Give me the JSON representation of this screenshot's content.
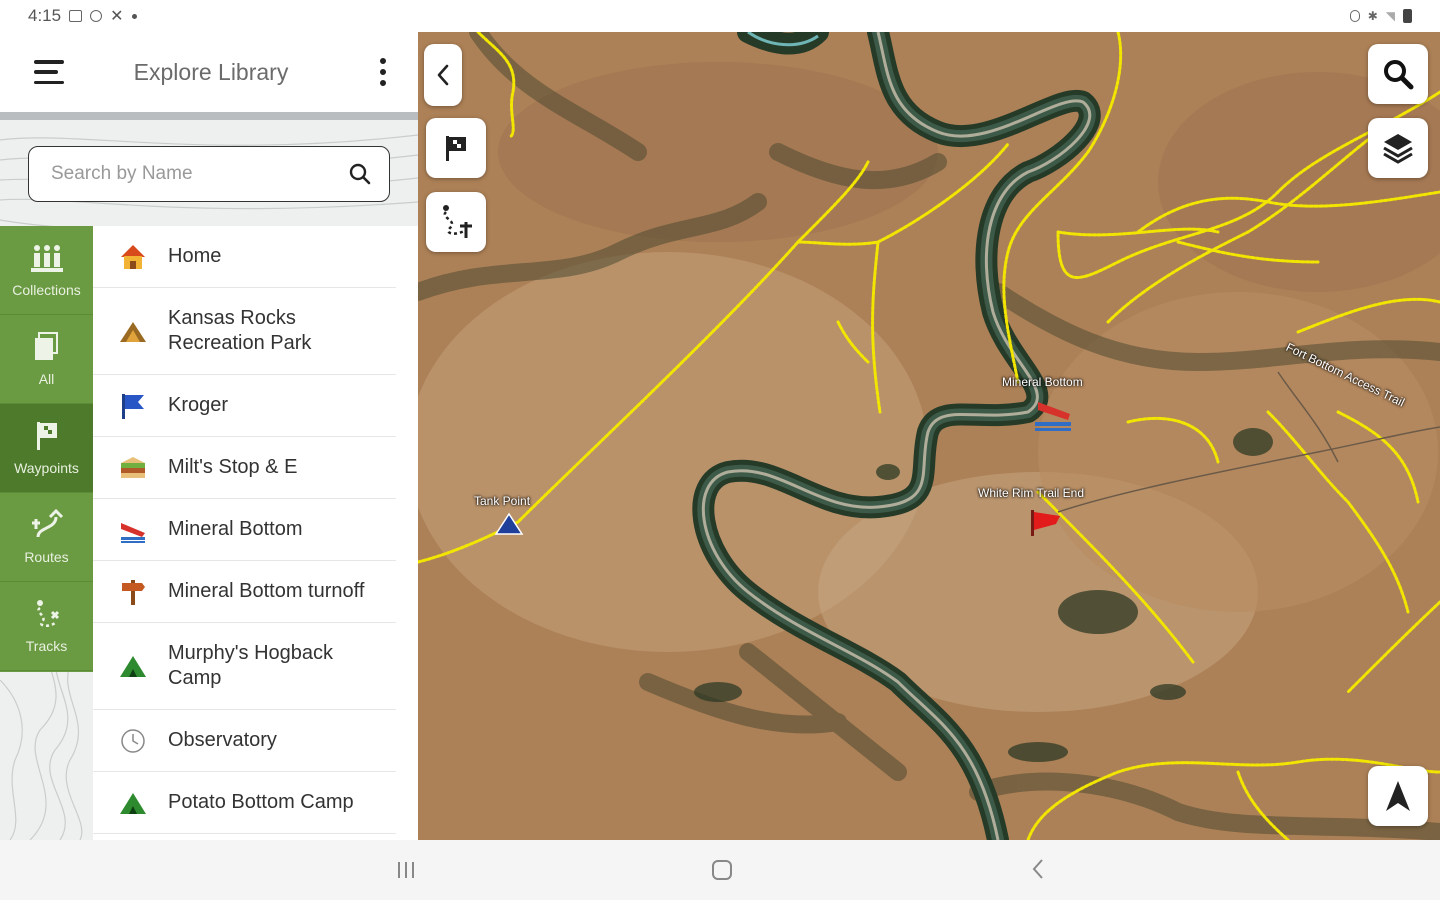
{
  "status_bar": {
    "time": "4:15"
  },
  "app": {
    "title": "Explore Library",
    "search": {
      "placeholder": "Search by Name",
      "value": ""
    }
  },
  "sidebar": {
    "tabs": [
      {
        "label": "Collections",
        "icon": "collections-icon",
        "active": false
      },
      {
        "label": "All",
        "icon": "all-icon",
        "active": false
      },
      {
        "label": "Waypoints",
        "icon": "waypoint-flag-icon",
        "active": true
      },
      {
        "label": "Routes",
        "icon": "route-icon",
        "active": false
      },
      {
        "label": "Tracks",
        "icon": "track-icon",
        "active": false
      }
    ]
  },
  "waypoints": [
    {
      "label": "Home",
      "icon": "home-icon"
    },
    {
      "label": "Kansas Rocks Recreation Park",
      "icon": "park-icon"
    },
    {
      "label": "Kroger",
      "icon": "flag-icon"
    },
    {
      "label": "Milt's Stop & E",
      "icon": "food-icon"
    },
    {
      "label": "Mineral Bottom",
      "icon": "boat-launch-icon"
    },
    {
      "label": "Mineral Bottom turnoff",
      "icon": "signpost-icon"
    },
    {
      "label": "Murphy's Hogback Camp",
      "icon": "campsite-icon"
    },
    {
      "label": "Observatory",
      "icon": "observatory-icon"
    },
    {
      "label": "Potato Bottom Camp",
      "icon": "campsite-icon"
    }
  ],
  "map": {
    "labels": {
      "mineral_bottom": "Mineral Bottom",
      "white_rim": "White Rim Trail End",
      "tank_point": "Tank Point",
      "road": "Fort Bottom Access Trail"
    }
  },
  "colors": {
    "sidebar_green": "#6a9a42",
    "sidebar_active": "#4d7a2b",
    "trail_yellow": "#f2e600"
  }
}
